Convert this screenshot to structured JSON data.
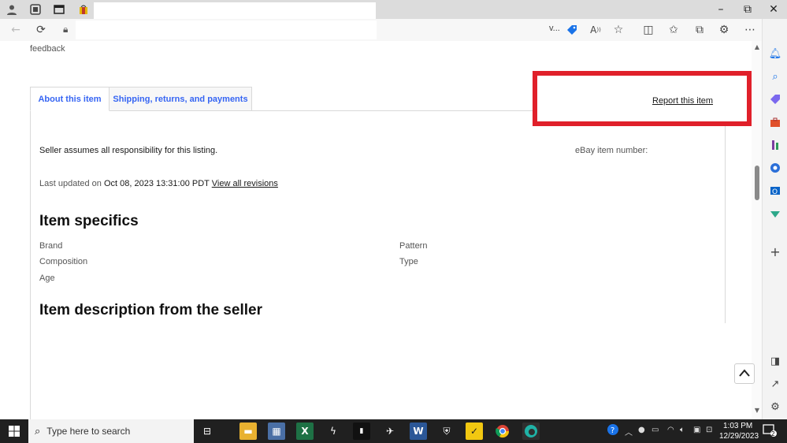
{
  "titlebar": {
    "window_controls": {
      "minimize": "–",
      "maximize": "⧉",
      "close": "✕"
    }
  },
  "toolbar": {
    "back": "←",
    "refresh": "⟳",
    "address_fragment": "v..."
  },
  "page": {
    "feedback_text": "feedback",
    "tabs": [
      {
        "label": "About this item",
        "active": true
      },
      {
        "label": "Shipping, returns, and payments",
        "active": false
      }
    ],
    "report_link": "Report this item",
    "seller_responsibility": "Seller assumes all responsibility for this listing.",
    "ebay_item_number_label": "eBay item number:",
    "last_updated_prefix": "Last updated on",
    "last_updated_date": "Oct 08, 2023 13:31:00 PDT",
    "view_revisions": "View all revisions",
    "item_specifics_heading": "Item specifics",
    "specifics_left": [
      "Brand",
      "Composition",
      "Age"
    ],
    "specifics_right": [
      "Pattern",
      "Type"
    ],
    "description_heading": "Item description from the seller"
  },
  "taskbar": {
    "search_placeholder": "Type here to search",
    "time": "1:03 PM",
    "date": "12/29/2023",
    "notification_count": "2"
  },
  "colors": {
    "accent_link": "#3665f3",
    "highlight_box": "#e0202a",
    "taskbar": "#202020"
  }
}
